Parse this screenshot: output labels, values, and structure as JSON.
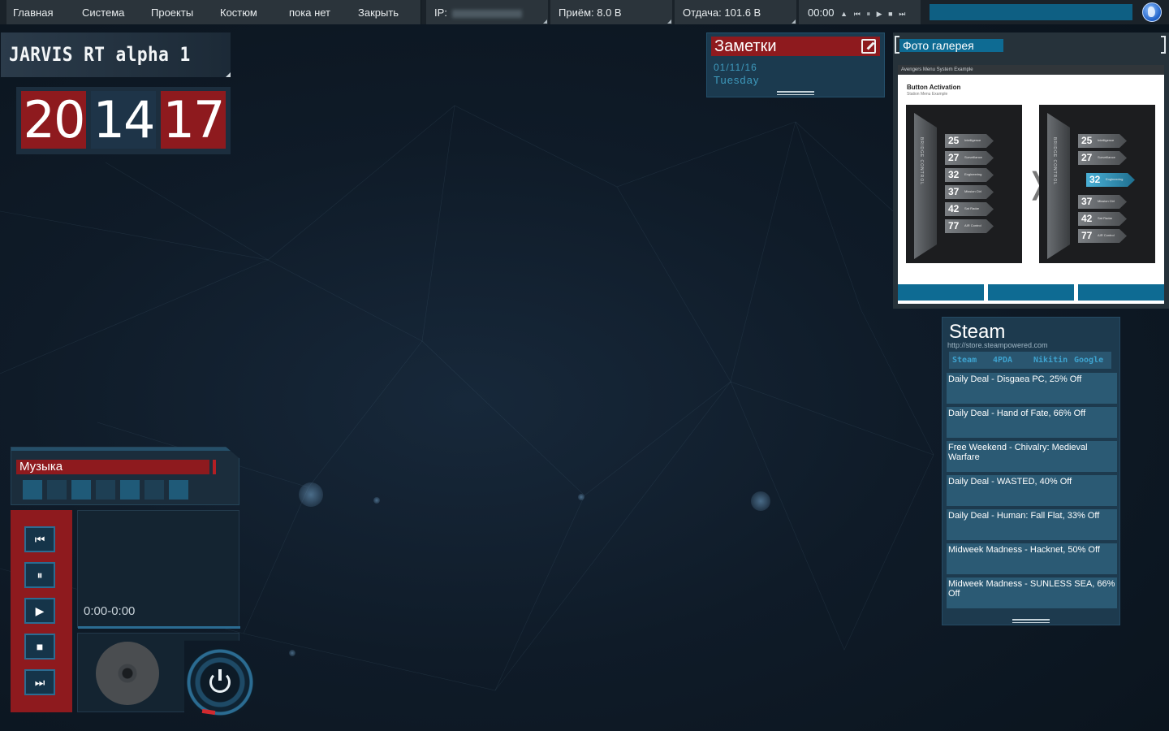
{
  "menu": {
    "items": [
      "Главная",
      "Система",
      "Проекты",
      "Костюм",
      "пока нет",
      "Закрыть"
    ]
  },
  "stats": {
    "ip_label": "IP:",
    "receive": "Приём: 8.0 B",
    "send": "Отдача: 101.6 B"
  },
  "mini_player": {
    "time": "00:00"
  },
  "title": "JARVIS RT alpha 1",
  "clock": {
    "hours": "20",
    "minutes": "14",
    "seconds": "17"
  },
  "notes": {
    "title": "Заметки",
    "date": "01/11/16",
    "day": "Tuesday"
  },
  "gallery": {
    "title": "Фото галерея",
    "photo": {
      "header": "Avengers   Menu System Example",
      "title": "Button Activation",
      "subtitle": "Station Menu Example",
      "pillar_text": "BRIDGE CONTROL",
      "items": [
        {
          "num": "25",
          "label": "Intelligence"
        },
        {
          "num": "27",
          "label": "Surveillance"
        },
        {
          "num": "32",
          "label": "Engineering"
        },
        {
          "num": "37",
          "label": "Mission Ctrl"
        },
        {
          "num": "42",
          "label": "Sat Radar"
        },
        {
          "num": "77",
          "label": "AIR Control"
        }
      ]
    }
  },
  "steam": {
    "title": "Steam",
    "url": "http://store.steampowered.com",
    "tabs": [
      "Steam",
      "4PDA",
      "Nikitin",
      "Google"
    ],
    "feed": [
      "Daily Deal - Disgaea PC, 25% Off",
      "Daily Deal - Hand of Fate, 66% Off",
      "Free Weekend - Chivalry: Medieval Warfare",
      "Daily Deal - WASTED, 40% Off",
      "Daily Deal - Human: Fall Flat, 33% Off",
      "Midweek Madness - Hacknet, 50% Off",
      "Midweek Madness - SUNLESS SEA, 66% Off"
    ]
  },
  "music": {
    "title": "Музыка",
    "time": "0:00-0:00"
  },
  "colors": {
    "accent_red": "#8e1a1e",
    "accent_blue": "#0e6b93",
    "panel": "#1d3a4e"
  },
  "icons": {
    "previous": "skip-previous-icon",
    "pause": "pause-icon",
    "play": "play-icon",
    "stop": "stop-icon",
    "next": "skip-next-icon",
    "power": "power-icon",
    "edit": "edit-icon",
    "globe": "globe-icon"
  }
}
